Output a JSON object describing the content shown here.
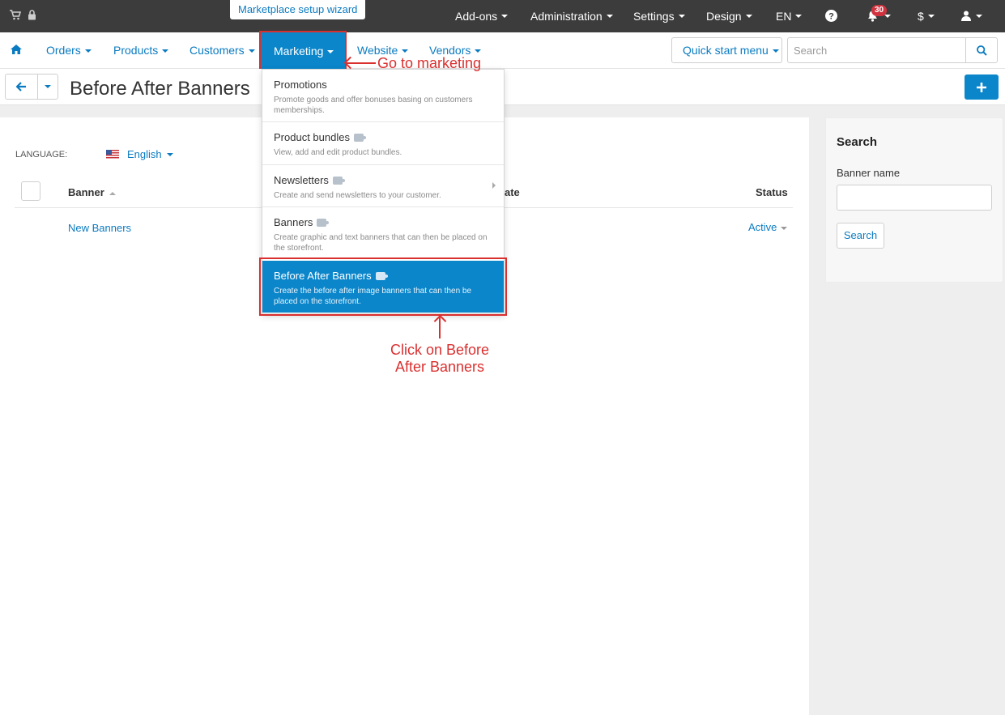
{
  "topbar": {
    "wizard_label": "Marketplace setup wizard",
    "items": [
      "Add-ons",
      "Administration",
      "Settings",
      "Design",
      "EN"
    ],
    "notification_count": "30",
    "currency": "$"
  },
  "navbar": {
    "orders": "Orders",
    "products": "Products",
    "customers": "Customers",
    "marketing": "Marketing",
    "website": "Website",
    "vendors": "Vendors",
    "quick_start": "Quick start menu",
    "search_placeholder": "Search"
  },
  "page": {
    "title": "Before After Banners"
  },
  "content": {
    "language_label": "LANGUAGE:",
    "language_value": "English",
    "columns": {
      "banner": "Banner",
      "date": "ate",
      "status": "Status"
    },
    "rows": [
      {
        "banner": "New Banners",
        "status": "Active"
      }
    ]
  },
  "sidebar": {
    "title": "Search",
    "field_label": "Banner name",
    "button": "Search"
  },
  "marketing_menu": [
    {
      "title": "Promotions",
      "desc": "Promote goods and offer bonuses basing on customers memberships."
    },
    {
      "title": "Product bundles",
      "desc": "View, add and edit product bundles."
    },
    {
      "title": "Newsletters",
      "desc": "Create and send newsletters to your customer."
    },
    {
      "title": "Banners",
      "desc": "Create graphic and text banners that can then be placed on the storefront."
    },
    {
      "title": "Before After Banners",
      "desc": "Create the before after image banners that can then be placed on the storefront."
    }
  ],
  "annotations": {
    "go_to_marketing": "Go to marketing",
    "click_line1": "Click on Before",
    "click_line2": "After Banners"
  },
  "colors": {
    "accent": "#0b86ca",
    "link": "#0b7bc1",
    "topbar": "#3c3c3c",
    "annotation": "#d9302f"
  }
}
